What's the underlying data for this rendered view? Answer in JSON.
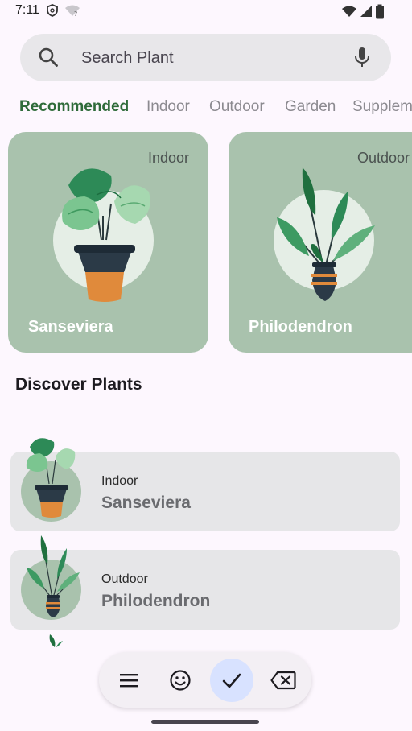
{
  "status_bar": {
    "time": "7:11",
    "icons": [
      "shield-icon",
      "wifi-question-icon",
      "wifi-icon",
      "signal-icon",
      "battery-icon"
    ]
  },
  "search": {
    "placeholder": "Search Plant",
    "icons": [
      "search-icon",
      "mic-icon"
    ]
  },
  "tabs": [
    {
      "label": "Recommended",
      "active": true
    },
    {
      "label": "Indoor",
      "active": false
    },
    {
      "label": "Outdoor",
      "active": false
    },
    {
      "label": "Garden",
      "active": false
    },
    {
      "label": "Supplement",
      "active": false
    }
  ],
  "featured_cards": [
    {
      "category": "Indoor",
      "name": "Sanseviera"
    },
    {
      "category": "Outdoor",
      "name": "Philodendron"
    }
  ],
  "discover": {
    "title": "Discover Plants",
    "items": [
      {
        "category": "Indoor",
        "name": "Sanseviera"
      },
      {
        "category": "Outdoor",
        "name": "Philodendron"
      }
    ]
  },
  "toolbar": {
    "buttons": [
      "menu-icon",
      "emoji-icon",
      "check-icon",
      "backspace-icon"
    ],
    "active": "check-icon"
  },
  "colors": {
    "accent": "#2f6b3a",
    "card_bg": "#a9c2ad",
    "background": "#fdf7fe"
  }
}
